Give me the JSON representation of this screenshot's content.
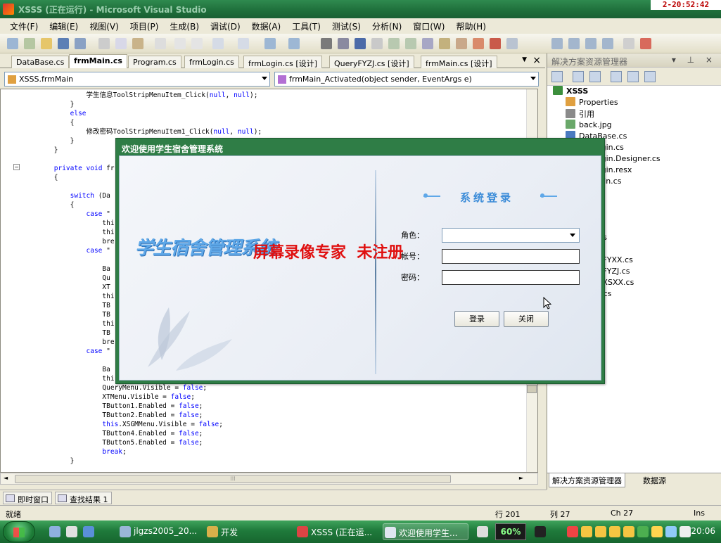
{
  "window": {
    "title": "XSSS (正在运行) - Microsoft Visual Studio",
    "clock": "2-20:52:42"
  },
  "menu": [
    "文件(F)",
    "编辑(E)",
    "视图(V)",
    "项目(P)",
    "生成(B)",
    "调试(D)",
    "数据(A)",
    "工具(T)",
    "测试(S)",
    "分析(N)",
    "窗口(W)",
    "帮助(H)"
  ],
  "doc_tabs": [
    "DataBase.cs",
    "frmMain.cs",
    "Program.cs",
    "frmLogin.cs",
    "frmLogin.cs [设计]",
    "QueryFYZJ.cs [设计]",
    "frmMain.cs [设计]"
  ],
  "combos": {
    "class": "XSSS.frmMain",
    "member": "frmMain_Activated(object sender, EventArgs e)"
  },
  "code_lines": [
    "                学生信息ToolStripMenuItem_Click(null, null);",
    "            }",
    "            else",
    "            {",
    "                修改密码ToolStripMenuItem1_Click(null, null);",
    "            }",
    "        }",
    "",
    "        private void fr",
    "        {",
    "",
    "            switch (Da",
    "            {",
    "                case \"",
    "                    thi",
    "                    thi",
    "                    bre",
    "                case \"",
    "",
    "                    Ba",
    "                    Qu",
    "                    XT",
    "                    thi",
    "                    TB",
    "                    TB",
    "                    thi",
    "                    TB",
    "                    bre",
    "                case \"",
    "",
    "                    Ba",
    "                    thi",
    "                    QueryMenu.Visible = false;",
    "                    XTMenu.Visible = false;",
    "                    TButton1.Enabled = false;",
    "                    TButton2.Enabled = false;",
    "                    this.XSGMMenu.Visible = false;",
    "                    TButton4.Enabled = false;",
    "                    TButton5.Enabled = false;",
    "                    break;",
    "            }"
  ],
  "solution_explorer": {
    "title": "解决方案资源管理器",
    "items": [
      "XSSS",
      "Properties",
      "引用",
      "back.jpg",
      "DataBase.cs",
      "frmLogin.cs",
      "frmLogin.Designer.cs",
      "frmLogin.resx",
      "frmMain.cs",
      "",
      "....cs",
      "....cs",
      "....gif",
      "....m.cs",
      "....cs",
      "QueryFYXX.cs",
      "QueryFYZJ.cs",
      "QueryXSXX.cs",
      "...Info.cs",
      "",
      "....cs",
      "",
      "....cs",
      "....s",
      "...st.cs",
      "....s"
    ],
    "tabs": [
      "解决方案资源管理器",
      "数据源"
    ]
  },
  "bottom_tabs": [
    "即时窗口",
    "查找结果 1"
  ],
  "status": {
    "left": "就绪",
    "row": "行 201",
    "col": "列 27",
    "ch": "Ch 27",
    "mode": "Ins"
  },
  "taskbar": {
    "items": [
      "jlgzs2005_20...",
      "开发",
      "XSSS (正在运...",
      "欢迎使用学生..."
    ],
    "percent": "60%",
    "time": "20:06"
  },
  "dialog": {
    "title": "欢迎使用学生宿舍管理系统",
    "brand": "学生宿舍管理系统",
    "heading": "系统登录",
    "role_label": "角色：",
    "account_label": "帐号：",
    "password_label": "密码：",
    "role_value": "",
    "account_value": "",
    "password_value": "",
    "login_button": "登录",
    "close_button": "关闭"
  },
  "watermark": "屏幕录像专家  未注册",
  "colors": {
    "title_green": "#2f8a4f",
    "keyword_blue": "#0000ff",
    "brand_blue": "#3a8bd8",
    "watermark_red": "#e01010"
  }
}
